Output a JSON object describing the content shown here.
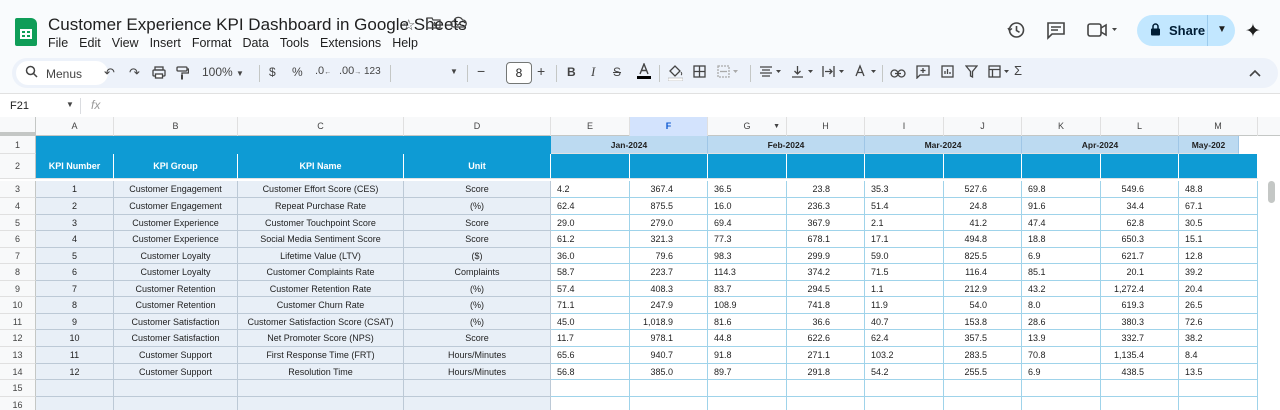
{
  "app": {
    "doc_title": "Customer Experience KPI Dashboard in Google Sheets",
    "menu": [
      "File",
      "Edit",
      "View",
      "Insert",
      "Format",
      "Data",
      "Tools",
      "Extensions",
      "Help"
    ],
    "share_label": "Share",
    "icons": [
      "star-icon",
      "folder-move-icon",
      "cloud-status-icon",
      "history-icon",
      "comment-icon",
      "meet-icon",
      "gemini-icon"
    ]
  },
  "toolbar": {
    "menus_label": "Menus",
    "zoom": "100%",
    "currency": "$",
    "percent": "%",
    "dec_less": ".0",
    "dec_more": ".00",
    "number_format": "123",
    "font_size": "8",
    "minus": "−",
    "plus": "+"
  },
  "formula_bar": {
    "name_box": "F21",
    "fx": "fx",
    "content": ""
  },
  "grid": {
    "column_letters": [
      "A",
      "B",
      "C",
      "D",
      "E",
      "F",
      "G",
      "H",
      "I",
      "J",
      "K",
      "L",
      "M"
    ],
    "selected_column": "F",
    "row_numbers": [
      "1",
      "2",
      "3",
      "4",
      "5",
      "6",
      "7",
      "8",
      "9",
      "10",
      "11",
      "12",
      "13",
      "14",
      "15",
      "16"
    ],
    "months": [
      "Jan-2024",
      "Feb-2024",
      "Mar-2024",
      "Apr-2024",
      "May-202"
    ],
    "headers": [
      "KPI Number",
      "KPI Group",
      "KPI Name",
      "Unit"
    ],
    "rows": [
      {
        "num": "1",
        "group": "Customer Engagement",
        "name": "Customer Effort Score (CES)",
        "unit": "Score",
        "vals": [
          "4.2",
          "367.4",
          "36.5",
          "23.8",
          "35.3",
          "527.6",
          "69.8",
          "549.6",
          "48.8"
        ]
      },
      {
        "num": "2",
        "group": "Customer Engagement",
        "name": "Repeat Purchase Rate",
        "unit": "(%)",
        "vals": [
          "62.4",
          "875.5",
          "16.0",
          "236.3",
          "51.4",
          "24.8",
          "91.6",
          "34.4",
          "67.1"
        ]
      },
      {
        "num": "3",
        "group": "Customer Experience",
        "name": "Customer Touchpoint Score",
        "unit": "Score",
        "vals": [
          "29.0",
          "279.0",
          "69.4",
          "367.9",
          "2.1",
          "41.2",
          "47.4",
          "62.8",
          "30.5"
        ]
      },
      {
        "num": "4",
        "group": "Customer Experience",
        "name": "Social Media Sentiment Score",
        "unit": "Score",
        "vals": [
          "61.2",
          "321.3",
          "77.3",
          "678.1",
          "17.1",
          "494.8",
          "18.8",
          "650.3",
          "15.1"
        ]
      },
      {
        "num": "5",
        "group": "Customer Loyalty",
        "name": "Lifetime Value (LTV)",
        "unit": "($)",
        "vals": [
          "36.0",
          "79.6",
          "98.3",
          "299.9",
          "59.0",
          "825.5",
          "6.9",
          "621.7",
          "12.8"
        ]
      },
      {
        "num": "6",
        "group": "Customer Loyalty",
        "name": "Customer Complaints Rate",
        "unit": "Complaints",
        "vals": [
          "58.7",
          "223.7",
          "114.3",
          "374.2",
          "71.5",
          "116.4",
          "85.1",
          "20.1",
          "39.2"
        ]
      },
      {
        "num": "7",
        "group": "Customer Retention",
        "name": "Customer Retention Rate",
        "unit": "(%)",
        "vals": [
          "57.4",
          "408.3",
          "83.7",
          "294.5",
          "1.1",
          "212.9",
          "43.2",
          "1,272.4",
          "20.4"
        ]
      },
      {
        "num": "8",
        "group": "Customer Retention",
        "name": "Customer Churn Rate",
        "unit": "(%)",
        "vals": [
          "71.1",
          "247.9",
          "108.9",
          "741.8",
          "11.9",
          "54.0",
          "8.0",
          "619.3",
          "26.5"
        ]
      },
      {
        "num": "9",
        "group": "Customer Satisfaction",
        "name": "Customer Satisfaction Score (CSAT)",
        "unit": "(%)",
        "vals": [
          "45.0",
          "1,018.9",
          "81.6",
          "36.6",
          "40.7",
          "153.8",
          "28.6",
          "380.3",
          "72.6"
        ]
      },
      {
        "num": "10",
        "group": "Customer Satisfaction",
        "name": "Net Promoter Score (NPS)",
        "unit": "Score",
        "vals": [
          "11.7",
          "978.1",
          "44.8",
          "622.6",
          "62.4",
          "357.5",
          "13.9",
          "332.7",
          "38.2"
        ]
      },
      {
        "num": "11",
        "group": "Customer Support",
        "name": "First Response Time (FRT)",
        "unit": "Hours/Minutes",
        "vals": [
          "65.6",
          "940.7",
          "91.8",
          "271.1",
          "103.2",
          "283.5",
          "70.8",
          "1,135.4",
          "8.4"
        ]
      },
      {
        "num": "12",
        "group": "Customer Support",
        "name": "Resolution Time",
        "unit": "Hours/Minutes",
        "vals": [
          "56.8",
          "385.0",
          "89.7",
          "291.8",
          "54.2",
          "255.5",
          "6.9",
          "438.5",
          "13.5"
        ]
      }
    ]
  },
  "colors": {
    "header_blue": "#0e9bd4",
    "month_band": "#bcdaf1",
    "left_body": "#e8eff7",
    "share_button": "#c2e7ff",
    "sheets_green": "#0f9d58"
  }
}
